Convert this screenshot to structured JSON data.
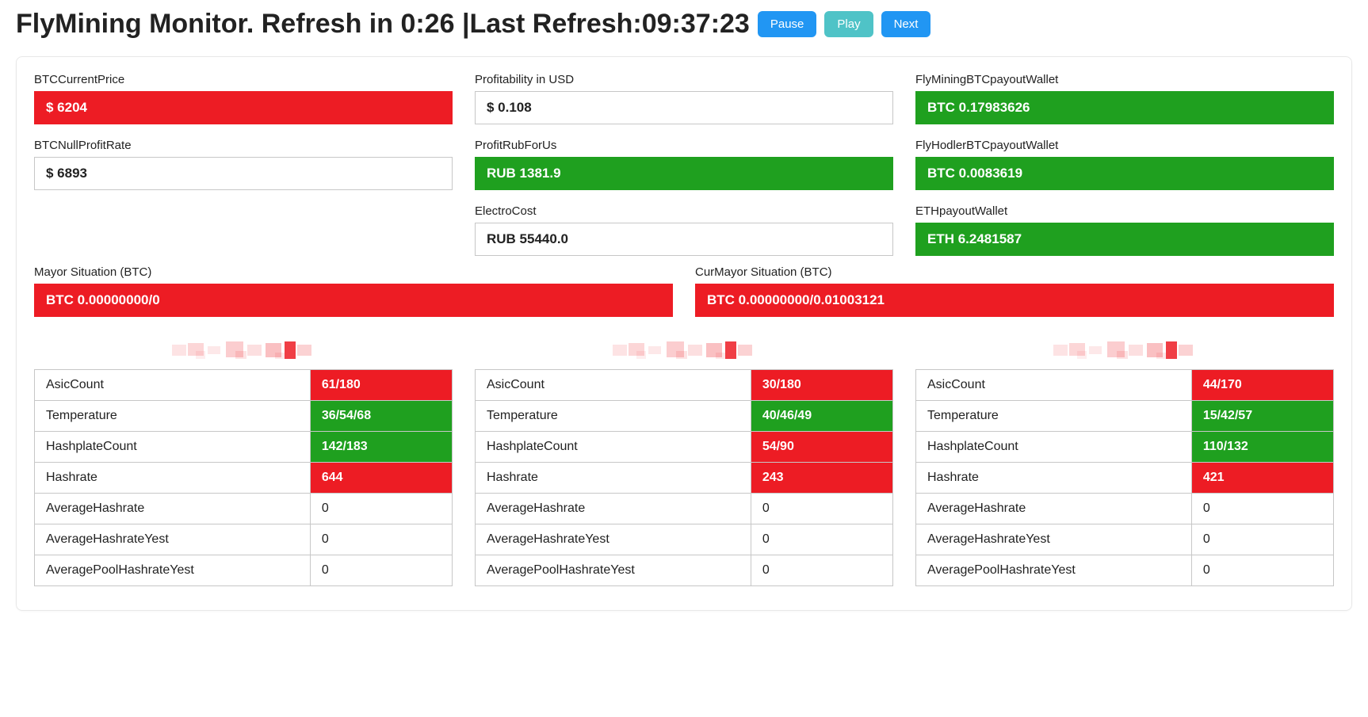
{
  "header": {
    "title": "FlyMining Monitor. Refresh in 0:26  |Last Refresh:09:37:23",
    "btn_pause": "Pause",
    "btn_play": "Play",
    "btn_next": "Next"
  },
  "top": {
    "c0r0_label": "BTCCurrentPrice",
    "c0r0_value": "$ 6204",
    "c0r0_status": "red",
    "c0r1_label": "BTCNullProfitRate",
    "c0r1_value": "$ 6893",
    "c0r1_status": "plain",
    "c1r0_label": "Profitability in USD",
    "c1r0_value": "$ 0.108",
    "c1r0_status": "plain",
    "c1r1_label": "ProfitRubForUs",
    "c1r1_value": "RUB 1381.9",
    "c1r1_status": "green",
    "c1r2_label": "ElectroCost",
    "c1r2_value": "RUB 55440.0",
    "c1r2_status": "plain",
    "c2r0_label": "FlyMiningBTCpayoutWallet",
    "c2r0_value": "BTC 0.17983626",
    "c2r0_status": "green",
    "c2r1_label": "FlyHodlerBTCpayoutWallet",
    "c2r1_value": "BTC 0.0083619",
    "c2r1_status": "green",
    "c2r2_label": "ETHpayoutWallet",
    "c2r2_value": "ETH 6.2481587",
    "c2r2_status": "green"
  },
  "mayor": {
    "left_label": "Mayor Situation (BTC)",
    "left_value": "BTC 0.00000000/0",
    "left_status": "red",
    "right_label": "CurMayor Situation (BTC)",
    "right_value": "BTC 0.00000000/0.01003121",
    "right_status": "red"
  },
  "miners": [
    {
      "rows": [
        {
          "label": "AsicCount",
          "value": "61/180",
          "status": "red"
        },
        {
          "label": "Temperature",
          "value": "36/54/68",
          "status": "green"
        },
        {
          "label": "HashplateCount",
          "value": "142/183",
          "status": "green"
        },
        {
          "label": "Hashrate",
          "value": "644",
          "status": "red"
        },
        {
          "label": "AverageHashrate",
          "value": "0",
          "status": "plain"
        },
        {
          "label": "AverageHashrateYest",
          "value": "0",
          "status": "plain"
        },
        {
          "label": "AveragePoolHashrateYest",
          "value": "0",
          "status": "plain"
        }
      ]
    },
    {
      "rows": [
        {
          "label": "AsicCount",
          "value": "30/180",
          "status": "red"
        },
        {
          "label": "Temperature",
          "value": "40/46/49",
          "status": "green"
        },
        {
          "label": "HashplateCount",
          "value": "54/90",
          "status": "red"
        },
        {
          "label": "Hashrate",
          "value": "243",
          "status": "red"
        },
        {
          "label": "AverageHashrate",
          "value": "0",
          "status": "plain"
        },
        {
          "label": "AverageHashrateYest",
          "value": "0",
          "status": "plain"
        },
        {
          "label": "AveragePoolHashrateYest",
          "value": "0",
          "status": "plain"
        }
      ]
    },
    {
      "rows": [
        {
          "label": "AsicCount",
          "value": "44/170",
          "status": "red"
        },
        {
          "label": "Temperature",
          "value": "15/42/57",
          "status": "green"
        },
        {
          "label": "HashplateCount",
          "value": "110/132",
          "status": "green"
        },
        {
          "label": "Hashrate",
          "value": "421",
          "status": "red"
        },
        {
          "label": "AverageHashrate",
          "value": "0",
          "status": "plain"
        },
        {
          "label": "AverageHashrateYest",
          "value": "0",
          "status": "plain"
        },
        {
          "label": "AveragePoolHashrateYest",
          "value": "0",
          "status": "plain"
        }
      ]
    }
  ]
}
